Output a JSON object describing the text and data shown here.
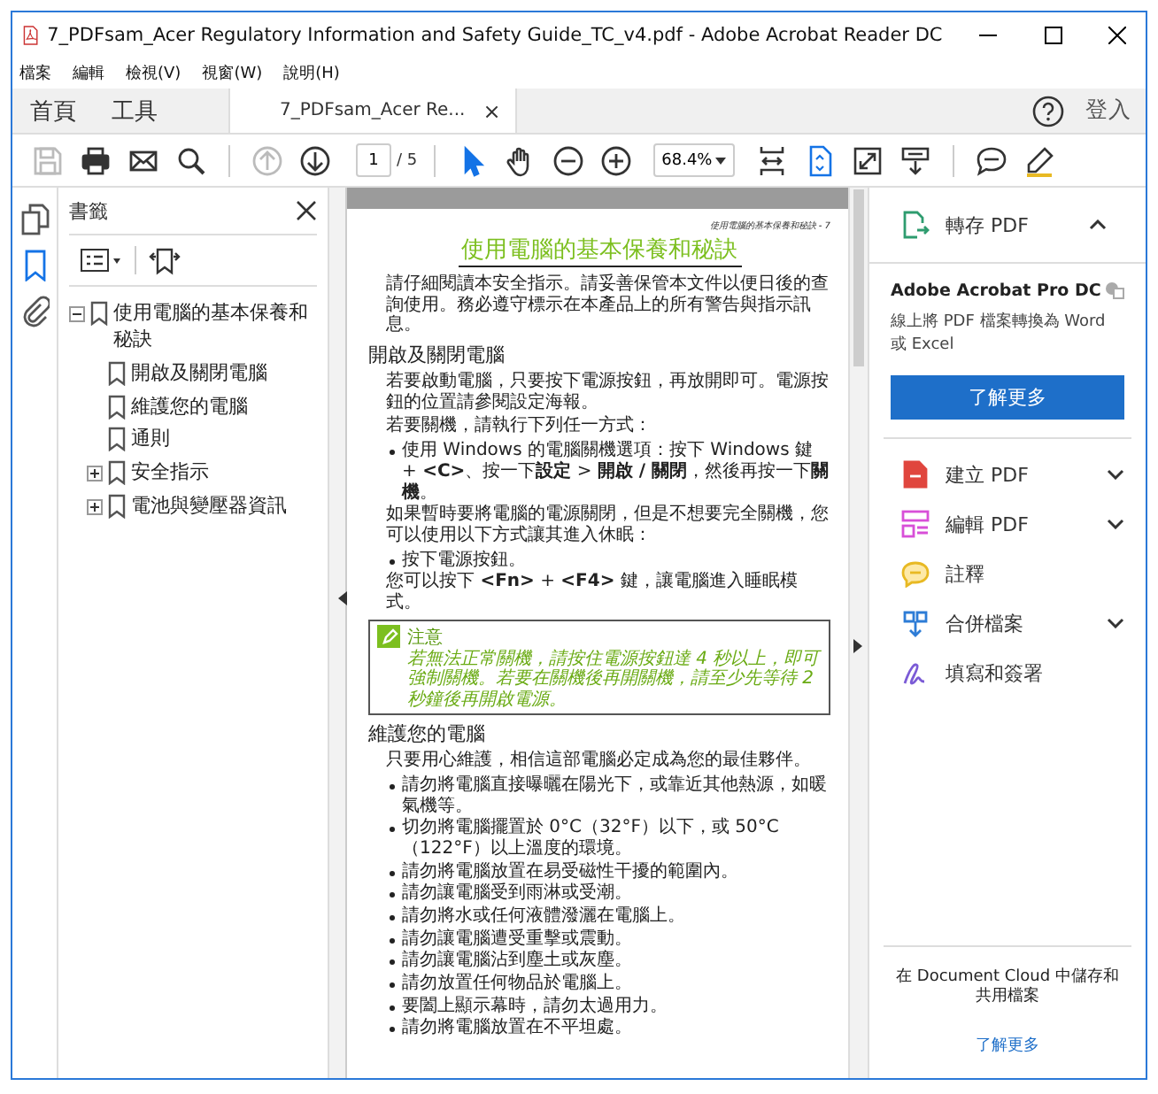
{
  "window": {
    "title": "7_PDFsam_Acer Regulatory Information and Safety Guide_TC_v4.pdf - Adobe Acrobat Reader DC"
  },
  "menu": [
    "檔案",
    "編輯",
    "檢視(V)",
    "視窗(W)",
    "說明(H)"
  ],
  "tabs": [
    {
      "label": "首頁",
      "selected": false
    },
    {
      "label": "工具",
      "selected": false
    },
    {
      "label": "7_PDFsam_Acer Re...",
      "selected": true,
      "close": "×"
    }
  ],
  "sign_in": "登入",
  "toolbar": {
    "file_tools": [
      {
        "disabled": true
      },
      {
        "disabled": false
      },
      {
        "disabled": false
      },
      {
        "disabled": false
      }
    ],
    "nav_tools": [
      {
        "disabled": true
      },
      {
        "disabled": false
      }
    ],
    "page_number": "1",
    "page_count": "/ 5",
    "pointer_tools": [
      {
        "selected": true
      },
      {
        "selected": false
      }
    ],
    "zoom": "68.4%",
    "view_tools": [
      {
        "selected": false
      },
      {
        "selected": true
      },
      {
        "selected": false
      },
      {
        "selected": false
      }
    ]
  },
  "side_rail": [
    {
      "selected": false
    },
    {
      "selected": true
    },
    {
      "selected": false
    }
  ],
  "bookmarks": {
    "title": "書籤",
    "items": [
      {
        "label": "使用電腦的基本保養和秘訣",
        "expanded": true,
        "children": [
          {
            "label": "開啟及關閉電腦"
          },
          {
            "label": "維護您的電腦"
          },
          {
            "label": "通則"
          },
          {
            "label": "安全指示",
            "expanded": false
          },
          {
            "label": "電池與變壓器資訊",
            "expanded": false
          }
        ]
      }
    ]
  },
  "page": {
    "header": "使用電腦的基本保養和秘訣 - 7",
    "title": "使用電腦的基本保養和秘訣",
    "blocks": [
      {
        "kind": "paragraph",
        "text": "請仔細閱讀本安全指示。請妥善保管本文件以便日後的查詢使用。務必遵守標示在本產品上的所有警告與指示訊息。"
      },
      {
        "kind": "heading",
        "text": "開啟及關閉電腦"
      },
      {
        "kind": "paragraph",
        "text": "若要啟動電腦，只要按下電源按鈕，再放開即可。電源按鈕的位置請參閱設定海報。"
      },
      {
        "kind": "paragraph",
        "text": "若要關機，請執行下列任一方式："
      },
      {
        "kind": "bullet",
        "text": "使用 Windows 的電腦關機選項：按下 Windows 鍵 + **<C>**、按一下**設定** > **開啟 / 關閉**，然後再按一下**關機**。"
      },
      {
        "kind": "paragraph",
        "text": "如果暫時要將電腦的電源關閉，但是不想要完全關機，您可以使用以下方式讓其進入休眠："
      },
      {
        "kind": "bullet",
        "text": "按下電源按鈕。"
      },
      {
        "kind": "paragraph",
        "text": "您可以按下 **<Fn>** + **<F4>** 鍵，讓電腦進入睡眠模式。"
      },
      {
        "kind": "note",
        "label": "注意",
        "text": "若無法正常關機，請按住電源按鈕達 4 秒以上，即可強制關機。若要在關機後再開關機，請至少先等待 2 秒鐘後再開啟電源。"
      },
      {
        "kind": "heading",
        "text": "維護您的電腦"
      },
      {
        "kind": "paragraph",
        "text": "只要用心維護，相信這部電腦必定成為您的最佳夥伴。"
      },
      {
        "kind": "bullet",
        "text": "請勿將電腦直接曝曬在陽光下，或靠近其他熱源，如暖氣機等。"
      },
      {
        "kind": "bullet",
        "text": "切勿將電腦擺置於 0°C（32°F）以下，或 50°C（122°F）以上溫度的環境。"
      },
      {
        "kind": "bullet",
        "text": "請勿將電腦放置在易受磁性干擾的範圍內。"
      },
      {
        "kind": "bullet",
        "text": "請勿讓電腦受到雨淋或受潮。"
      },
      {
        "kind": "bullet",
        "text": "請勿將水或任何液體潑灑在電腦上。"
      },
      {
        "kind": "bullet",
        "text": "請勿讓電腦遭受重擊或震動。"
      },
      {
        "kind": "bullet",
        "text": "請勿讓電腦沾到塵土或灰塵。"
      },
      {
        "kind": "bullet",
        "text": "請勿放置任何物品於電腦上。"
      },
      {
        "kind": "bullet",
        "text": "要闔上顯示幕時，請勿太過用力。"
      },
      {
        "kind": "bullet",
        "text": "請勿將電腦放置在不平坦處。"
      }
    ]
  },
  "tools": [
    {
      "label": "轉存 PDF",
      "expanded": true
    },
    {
      "label": "建立 PDF",
      "expanded": false
    },
    {
      "label": "編輯 PDF",
      "expanded": false
    },
    {
      "label": "註釋"
    },
    {
      "label": "合併檔案",
      "expanded": false
    },
    {
      "label": "填寫和簽署"
    }
  ],
  "promo": {
    "title": "Adobe Acrobat Pro DC",
    "text": "線上將 PDF 檔案轉換為 Word 或 Excel",
    "button": "了解更多"
  },
  "cloud": {
    "text": "在 Document Cloud 中儲存和共用檔案",
    "link": "了解更多"
  }
}
